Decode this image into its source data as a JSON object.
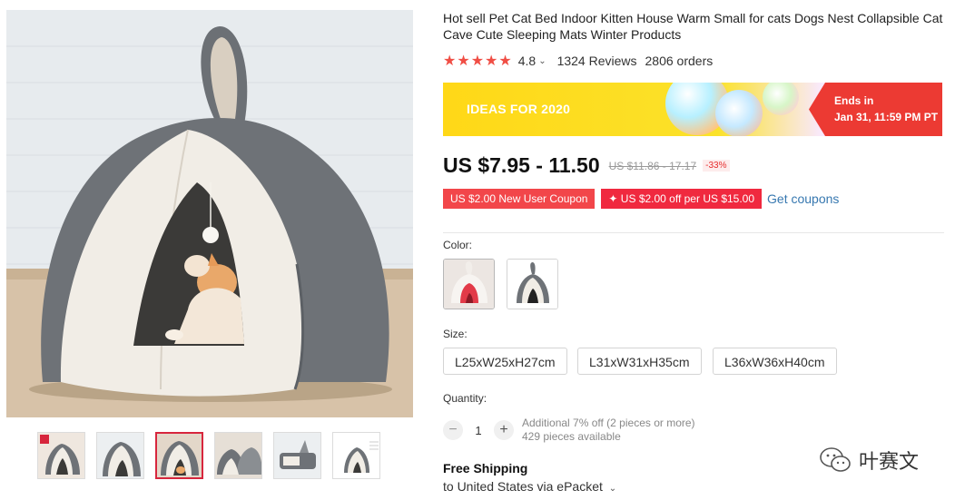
{
  "product": {
    "title": "Hot sell Pet Cat Bed Indoor Kitten House Warm Small for cats Dogs Nest Collapsible Cat Cave Cute Sleeping Mats Winter Products",
    "rating": "4.8",
    "reviews": "1324 Reviews",
    "orders": "2806 orders"
  },
  "banner": {
    "label": "IDEAS FOR 2020",
    "ends_label": "Ends in",
    "ends_time": "Jan 31, 11:59 PM PT"
  },
  "price": {
    "current": "US $7.95 - 11.50",
    "original": "US $11.86 - 17.17",
    "discount": "-33%"
  },
  "coupons": {
    "new_user": "US $2.00 New User Coupon",
    "store": "✦ US $2.00 off per US $15.00",
    "get": "Get coupons"
  },
  "color": {
    "label": "Color:",
    "selected": 1
  },
  "size": {
    "label": "Size:",
    "options": [
      "L25xW25xH27cm",
      "L31xW31xH35cm",
      "L36xW36xH40cm"
    ]
  },
  "quantity": {
    "label": "Quantity:",
    "value": "1",
    "minus": "−",
    "plus": "+",
    "offer": "Additional 7% off (2 pieces or more)",
    "available": "429 pieces available"
  },
  "shipping": {
    "title": "Free Shipping",
    "destination": "to United States via ePacket"
  },
  "gallery": {
    "thumb_count": 6,
    "active_thumb": 2
  },
  "watermark": {
    "text": "叶赛文"
  },
  "colors": {
    "star": "#f04e45",
    "banner_yellow": "#ffd817",
    "ends_red": "#ec3a33",
    "coupon_red": "#f2464a",
    "link_blue": "#3778b0",
    "bed_gray": "#6e7277",
    "bed_cream": "#f1ede6"
  }
}
